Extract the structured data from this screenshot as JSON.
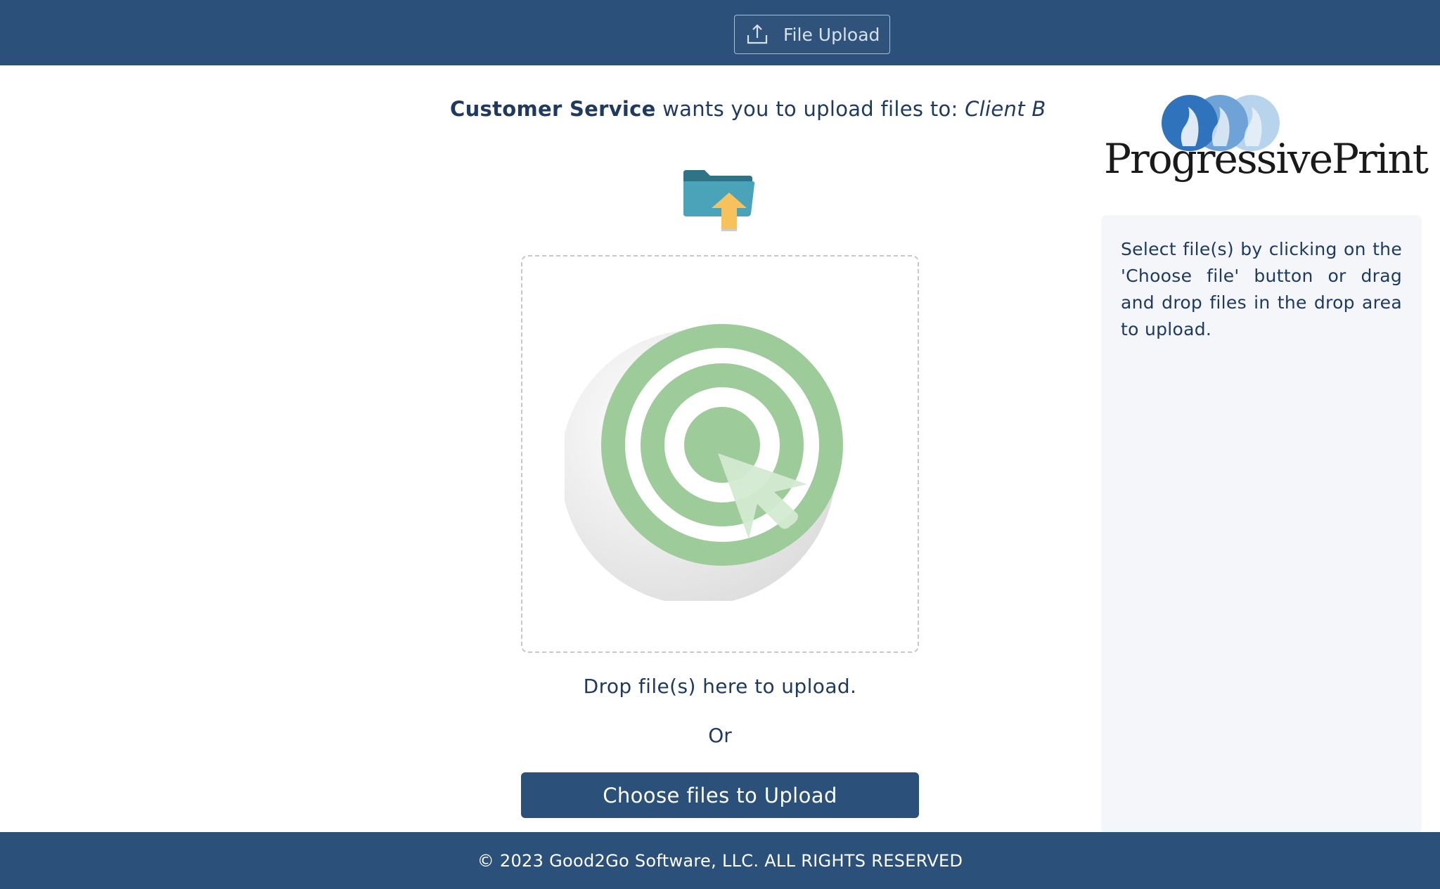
{
  "header": {
    "tab_label": "File Upload",
    "tab_icon": "upload-tray-icon"
  },
  "request": {
    "sender": "Customer Service",
    "middle_text": " wants you to upload files to: ",
    "destination": "Client B"
  },
  "drop_zone": {
    "graphic": "target-icon",
    "drop_text": "Drop file(s) here to upload.",
    "or_text": "Or",
    "choose_button_label": "Choose files to Upload"
  },
  "brand": {
    "logo_text": "ProgressivePrint"
  },
  "sidebar": {
    "instructions": "Select file(s) by clicking on the 'Choose file' button or drag and drop files in the drop area to upload."
  },
  "footer": {
    "copyright": "© 2023 Good2Go Software, LLC. ALL RIGHTS RESERVED"
  },
  "colors": {
    "nav_bg": "#2b5079",
    "text_primary": "#1f3a60",
    "panel_bg": "#f4f6f9",
    "target_green": "#9ecb9a",
    "folder_teal": "#4aa3b8",
    "arrow_yellow": "#f7c15c"
  }
}
